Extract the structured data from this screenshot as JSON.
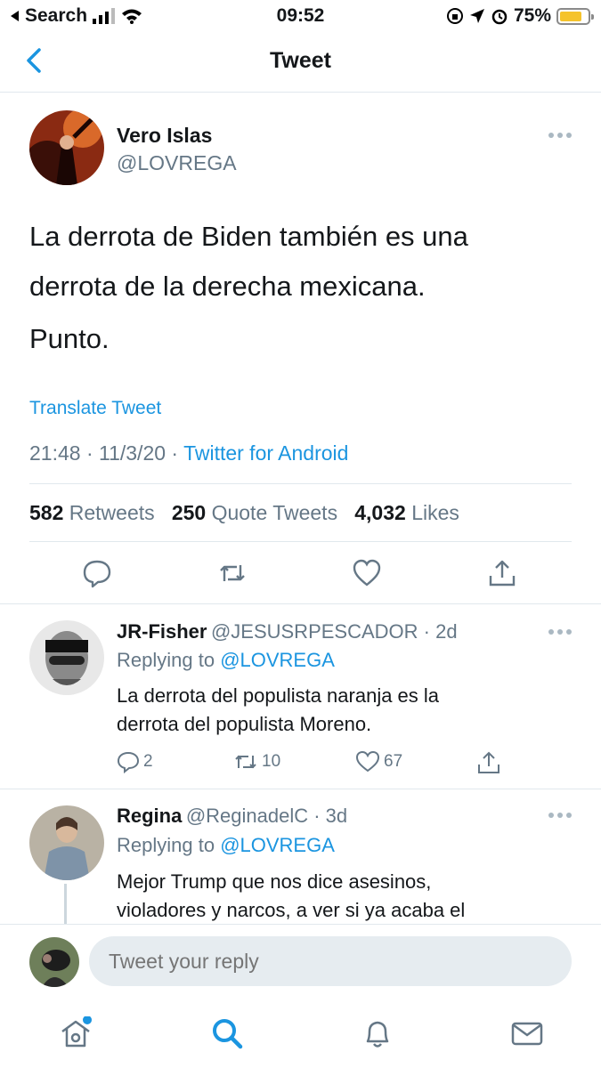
{
  "status_bar": {
    "back_app": "Search",
    "time": "09:52",
    "battery": "75%"
  },
  "header": {
    "title": "Tweet"
  },
  "tweet": {
    "author_name": "Vero Islas",
    "author_handle": "@LOVREGA",
    "text_line1": "La derrota de Biden también es una",
    "text_line2": "derrota de la derecha mexicana.",
    "text_line3": "Punto.",
    "translate_label": "Translate Tweet",
    "timestamp": "21:48 · 11/3/20 · ",
    "source": "Twitter for Android",
    "retweets_count": "582",
    "retweets_label": "Retweets",
    "quotes_count": "250",
    "quotes_label": "Quote Tweets",
    "likes_count": "4,032",
    "likes_label": "Likes"
  },
  "replies": [
    {
      "name": "JR-Fisher",
      "handle_time": "@JESUSRPESCADOR · 2d",
      "replying_prefix": "Replying to ",
      "replying_to": "@LOVREGA",
      "text_line1": "La derrota del populista naranja es la",
      "text_line2": "derrota del populista Moreno.",
      "reply_count": "2",
      "retweet_count": "10",
      "like_count": "67"
    },
    {
      "name": "Regina",
      "handle_time": "@ReginadelC · 3d",
      "replying_prefix": "Replying to ",
      "replying_to": "@LOVREGA",
      "text_line1": "Mejor Trump que nos dice asesinos,",
      "text_line2": "violadores y narcos, a ver si ya acaba el"
    }
  ],
  "composer": {
    "placeholder": "Tweet your reply"
  },
  "tab_bar": {
    "items": [
      "home-icon",
      "search-icon",
      "notifications-icon",
      "messages-icon"
    ]
  },
  "colors": {
    "accent": "#1b95e0",
    "secondary_text": "#657786",
    "divider": "#e1e8ed"
  }
}
